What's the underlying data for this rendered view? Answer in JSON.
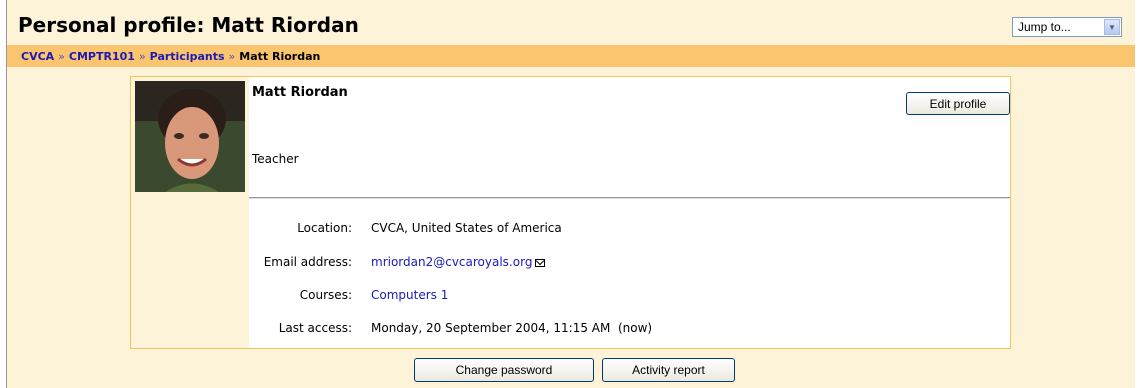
{
  "header": {
    "title": "Personal profile: Matt Riordan",
    "jump_to": "Jump to..."
  },
  "breadcrumb": {
    "items": [
      "CVCA",
      "CMPTR101",
      "Participants"
    ],
    "separator": "»",
    "current": "Matt Riordan"
  },
  "profile": {
    "name": "Matt Riordan",
    "role": "Teacher",
    "edit_label": "Edit profile",
    "fields": [
      {
        "label": "Location:",
        "value": "CVCA, United States of America"
      },
      {
        "label": "Email address:",
        "value": "mriordan2@cvcaroyals.org"
      },
      {
        "label": "Courses:",
        "value": "Computers 1"
      },
      {
        "label": "Last access:",
        "value": "Monday, 20 September 2004, 11:15 AM  (now)"
      }
    ]
  },
  "actions": {
    "change_password": "Change password",
    "activity_report": "Activity report"
  },
  "colors": {
    "page_bg": "#fdf3d8",
    "nav_bg": "#fbc46e",
    "link": "#1a1ab6",
    "box_border": "#f1c75b"
  },
  "icons": {
    "dropdown": "chevron-down-icon",
    "email": "envelope-icon"
  }
}
